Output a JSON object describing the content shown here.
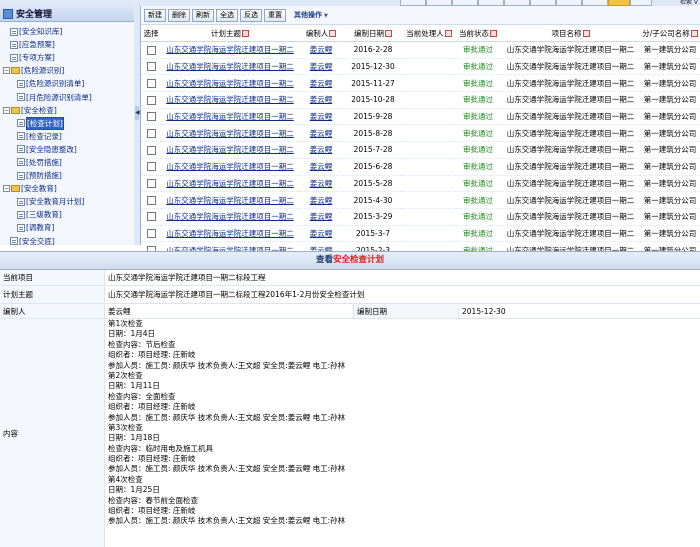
{
  "topbar": {
    "search_label": "检索 V"
  },
  "sidebar": {
    "title": "安全管理",
    "items": [
      {
        "label": "[安全知识库]",
        "kind": "doc",
        "indent": 1
      },
      {
        "label": "[应急预案]",
        "kind": "doc",
        "indent": 1
      },
      {
        "label": "[专项方案]",
        "kind": "doc",
        "indent": 1
      },
      {
        "label": "[危险源识别]",
        "kind": "folder",
        "indent": 0
      },
      {
        "label": "[危险源识别清单]",
        "kind": "doc",
        "indent": 2
      },
      {
        "label": "[月危险源识别清单]",
        "kind": "doc",
        "indent": 2
      },
      {
        "label": "[安全检查]",
        "kind": "folder",
        "indent": 0
      },
      {
        "label": "[检查计划]",
        "kind": "doc",
        "indent": 2,
        "selected": true
      },
      {
        "label": "[检查记录]",
        "kind": "doc",
        "indent": 2
      },
      {
        "label": "[安全隐患整改]",
        "kind": "doc",
        "indent": 2
      },
      {
        "label": "[处罚措施]",
        "kind": "doc",
        "indent": 2
      },
      {
        "label": "[预防措施]",
        "kind": "doc",
        "indent": 2
      },
      {
        "label": "[安全教育]",
        "kind": "folder",
        "indent": 0
      },
      {
        "label": "[安全教育月计划]",
        "kind": "doc",
        "indent": 2
      },
      {
        "label": "[三级教育]",
        "kind": "doc",
        "indent": 2
      },
      {
        "label": "[调教育]",
        "kind": "doc",
        "indent": 2
      },
      {
        "label": "[安全交底]",
        "kind": "doc",
        "indent": 1
      }
    ]
  },
  "toolbar": {
    "buttons": [
      "新建",
      "删除",
      "刷新",
      "全选",
      "反选",
      "重置"
    ],
    "more_label": "其他操作"
  },
  "grid": {
    "columns": [
      "选择",
      "计划主题",
      "编制人",
      "编制日期",
      "当前处理人",
      "当前状态",
      "项目名称",
      "分/子公司名称"
    ],
    "rows": [
      {
        "subject": "山东交通学院海运学院迁建项目一期二",
        "author": "姜云鲤",
        "date": "2016-2-28",
        "handler": "",
        "status": "审批通过",
        "project": "山东交通学院海运学院迁建项目一期二",
        "company": "第一建筑分公司"
      },
      {
        "subject": "山东交通学院海运学院迁建项目一期二",
        "author": "姜云鲤",
        "date": "2015-12-30",
        "handler": "",
        "status": "审批通过",
        "project": "山东交通学院海运学院迁建项目一期二",
        "company": "第一建筑分公司"
      },
      {
        "subject": "山东交通学院海运学院迁建项目一期二",
        "author": "姜云鲤",
        "date": "2015-11-27",
        "handler": "",
        "status": "审批通过",
        "project": "山东交通学院海运学院迁建项目一期二",
        "company": "第一建筑分公司"
      },
      {
        "subject": "山东交通学院海运学院迁建项目一期二",
        "author": "姜云鲤",
        "date": "2015-10-28",
        "handler": "",
        "status": "审批通过",
        "project": "山东交通学院海运学院迁建项目一期二",
        "company": "第一建筑分公司"
      },
      {
        "subject": "山东交通学院海运学院迁建项目一期二",
        "author": "姜云鲤",
        "date": "2015-9-28",
        "handler": "",
        "status": "审批通过",
        "project": "山东交通学院海运学院迁建项目一期二",
        "company": "第一建筑分公司"
      },
      {
        "subject": "山东交通学院海运学院迁建项目一期二",
        "author": "姜云鲤",
        "date": "2015-8-28",
        "handler": "",
        "status": "审批通过",
        "project": "山东交通学院海运学院迁建项目一期二",
        "company": "第一建筑分公司"
      },
      {
        "subject": "山东交通学院海运学院迁建项目一期二",
        "author": "姜云鲤",
        "date": "2015-7-28",
        "handler": "",
        "status": "审批通过",
        "project": "山东交通学院海运学院迁建项目一期二",
        "company": "第一建筑分公司"
      },
      {
        "subject": "山东交通学院海运学院迁建项目一期二",
        "author": "姜云鲤",
        "date": "2015-6-28",
        "handler": "",
        "status": "审批通过",
        "project": "山东交通学院海运学院迁建项目一期二",
        "company": "第一建筑分公司"
      },
      {
        "subject": "山东交通学院海运学院迁建项目一期二",
        "author": "姜云鲤",
        "date": "2015-5-28",
        "handler": "",
        "status": "审批通过",
        "project": "山东交通学院海运学院迁建项目一期二",
        "company": "第一建筑分公司"
      },
      {
        "subject": "山东交通学院海运学院迁建项目一期二",
        "author": "姜云鲤",
        "date": "2015-4-30",
        "handler": "",
        "status": "审批通过",
        "project": "山东交通学院海运学院迁建项目一期二",
        "company": "第一建筑分公司"
      },
      {
        "subject": "山东交通学院海运学院迁建项目一期二",
        "author": "姜云鲤",
        "date": "2015-3-29",
        "handler": "",
        "status": "审批通过",
        "project": "山东交通学院海运学院迁建项目一期二",
        "company": "第一建筑分公司"
      },
      {
        "subject": "山东交通学院海运学院迁建项目一期二",
        "author": "姜云鲤",
        "date": "2015-3-7",
        "handler": "",
        "status": "审批通过",
        "project": "山东交通学院海运学院迁建项目一期二",
        "company": "第一建筑分公司"
      },
      {
        "subject": "山东交通学院海运学院迁建项目一期二",
        "author": "姜云鲤",
        "date": "2015-2-3",
        "handler": "",
        "status": "审批通过",
        "project": "山东交通学院海运学院迁建项目一期二",
        "company": "第一建筑分公司"
      }
    ]
  },
  "detail": {
    "heading_prefix": "查看",
    "heading_highlight": "安全检查计划",
    "project_label": "当前项目",
    "project_value": "山东交通学院海运学院迁建项目一期二标段工程",
    "subject_label": "计划主题",
    "subject_value": "山东交通学院海运学院迁建项目一期二标段工程2016年1-2月份安全检查计划",
    "author_label": "编制人",
    "author_value": "姜云鲤",
    "date_label": "编制日期",
    "date_value": "2015-12-30",
    "content_label": "内容",
    "content_lines": [
      "第1次检查",
      "日期：1月4日",
      "检查内容：节后检查",
      "组织者：项目经理: 庄新岐",
      "参加人员：施工员: 颜庆华 技术负责人:王文超 安全员:姜云鲤 电工:孙林",
      "第2次检查",
      "日期：1月11日",
      "检查内容：全面检查",
      "组织者：项目经理: 庄新岐",
      "参加人员：施工员: 颜庆华 技术负责人:王文超 安全员:姜云鲤 电工:孙林",
      "第3次检查",
      "日期：1月18日",
      "检查内容：临时用电及施工机具",
      "组织者：项目经理: 庄新岐",
      "参加人员：施工员: 颜庆华 技术负责人:王文超 安全员:姜云鲤 电工:孙林",
      "第4次检查",
      "日期：1月25日",
      "检查内容：春节前全面检查",
      "组织者：项目经理: 庄新岐",
      "参加人员：施工员: 颜庆华 技术负责人:王文超 安全员:姜云鲤 电工:孙林"
    ]
  }
}
